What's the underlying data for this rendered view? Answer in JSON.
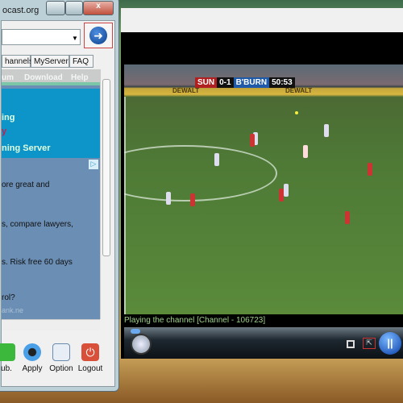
{
  "left_window": {
    "title": "ocast.org",
    "tabs": [
      "hannels",
      "MyServer",
      "FAQ"
    ],
    "web_nav": [
      "um",
      "Download",
      "Help"
    ],
    "banner_lines": [
      "ing",
      "y",
      "ning Server"
    ],
    "ad_lines": [
      "ore great and",
      "s, compare lawyers,",
      "s. Risk free 60 days",
      "rol?",
      "ank.ne"
    ],
    "buttons": [
      {
        "label": "ub.",
        "icon": "plus-icon"
      },
      {
        "label": "Apply",
        "icon": "speaker-icon"
      },
      {
        "label": "Option",
        "icon": "checklist-icon"
      },
      {
        "label": "Logout",
        "icon": "power-icon"
      }
    ]
  },
  "player": {
    "scoreboard": {
      "home": "SUN",
      "score": "0-1",
      "away": "B'BURN",
      "time": "50:53"
    },
    "ad_board": "DEWALT",
    "status": "Playing the channel [Channel - 106723]"
  }
}
